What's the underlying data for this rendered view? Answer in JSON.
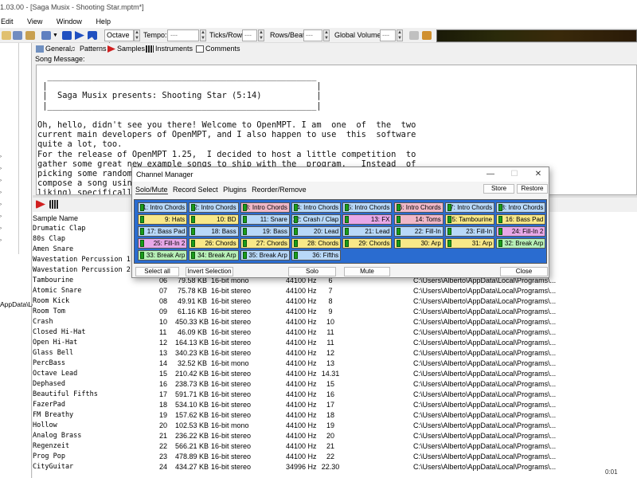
{
  "window": {
    "title": "1.03.00 - [Saga Musix - Shooting Star.mptm*]"
  },
  "menu": [
    "Edit",
    "View",
    "Window",
    "Help"
  ],
  "toolbar": {
    "octave": "Octave 4",
    "tempo_label": "Tempo:",
    "tempo_value": "---",
    "ticks_label": "Ticks/Row:",
    "ticks_value": "---",
    "rows_label": "Rows/Beat:",
    "rows_value": "---",
    "volume_label": "Global Volume:",
    "volume_value": "---"
  },
  "left_pane": {
    "label": "AppData\\Lo"
  },
  "tabs": [
    "General",
    "Patterns",
    "Samples",
    "Instruments",
    "Comments"
  ],
  "song_message_label": "Song Message:",
  "song_message": "  ______________________________________________________\n |                                                      |\n |  Saga Musix presents: Shooting Star (5:14)           |\n |______________________________________________________|\n\nOh, hello, didn't see you there! Welcome to OpenMPT. I am  one  of  the  two\ncurrent main developers of OpenMPT, and I also happen to use  this  software\nquite a lot, too.\nFor the release of OpenMPT 1.25,  I decided to host a little competition  to\ngather some great new example songs to ship with the  program.   Instead  of\npicking some random songs from my favourite  module  artists,  I  let  them\ncompose a song using\nliking) specifically",
  "sample_list": {
    "header": "Sample Name",
    "rows": [
      {
        "name": "Drumatic Clap",
        "num": "",
        "size": "",
        "fmt": "",
        "rate": "",
        "note": "",
        "path": ""
      },
      {
        "name": "80s Clap",
        "num": "",
        "size": "",
        "fmt": "",
        "rate": "",
        "note": "",
        "path": ""
      },
      {
        "name": "Amen Snare",
        "num": "",
        "size": "",
        "fmt": "",
        "rate": "",
        "note": "",
        "path": ""
      },
      {
        "name": "Wavestation Percussion 1",
        "num": "",
        "size": "",
        "fmt": "",
        "rate": "",
        "note": "",
        "path": ""
      },
      {
        "name": "Wavestation Percussion 2",
        "num": "",
        "size": "",
        "fmt": "",
        "rate": "",
        "note": "",
        "path": ""
      },
      {
        "name": "Tambourine",
        "num": "06",
        "size": "79.58 KB",
        "fmt": "16-bit mono",
        "rate": "44100 Hz",
        "note": "6",
        "path": "C:\\Users\\Alberto\\AppData\\Local\\Programs\\..."
      },
      {
        "name": "Atomic Snare",
        "num": "07",
        "size": "75.78 KB",
        "fmt": "16-bit stereo",
        "rate": "44100 Hz",
        "note": "7",
        "path": "C:\\Users\\Alberto\\AppData\\Local\\Programs\\..."
      },
      {
        "name": "Room Kick",
        "num": "08",
        "size": "49.91 KB",
        "fmt": "16-bit stereo",
        "rate": "44100 Hz",
        "note": "8",
        "path": "C:\\Users\\Alberto\\AppData\\Local\\Programs\\..."
      },
      {
        "name": "Room Tom",
        "num": "09",
        "size": "61.16 KB",
        "fmt": "16-bit stereo",
        "rate": "44100 Hz",
        "note": "9",
        "path": "C:\\Users\\Alberto\\AppData\\Local\\Programs\\..."
      },
      {
        "name": "Crash",
        "num": "10",
        "size": "450.33 KB",
        "fmt": "16-bit stereo",
        "rate": "44100 Hz",
        "note": "10",
        "path": "C:\\Users\\Alberto\\AppData\\Local\\Programs\\..."
      },
      {
        "name": "Closed Hi-Hat",
        "num": "11",
        "size": "46.09 KB",
        "fmt": "16-bit stereo",
        "rate": "44100 Hz",
        "note": "11",
        "path": "C:\\Users\\Alberto\\AppData\\Local\\Programs\\..."
      },
      {
        "name": "Open Hi-Hat",
        "num": "12",
        "size": "164.13 KB",
        "fmt": "16-bit stereo",
        "rate": "44100 Hz",
        "note": "11",
        "path": "C:\\Users\\Alberto\\AppData\\Local\\Programs\\..."
      },
      {
        "name": "Glass Bell",
        "num": "13",
        "size": "340.23 KB",
        "fmt": "16-bit stereo",
        "rate": "44100 Hz",
        "note": "12",
        "path": "C:\\Users\\Alberto\\AppData\\Local\\Programs\\..."
      },
      {
        "name": "PercBass",
        "num": "14",
        "size": "32.52 KB",
        "fmt": "16-bit mono",
        "rate": "44100 Hz",
        "note": "13",
        "path": "C:\\Users\\Alberto\\AppData\\Local\\Programs\\..."
      },
      {
        "name": "Octave Lead",
        "num": "15",
        "size": "210.42 KB",
        "fmt": "16-bit stereo",
        "rate": "44100 Hz",
        "note": "14.31",
        "path": "C:\\Users\\Alberto\\AppData\\Local\\Programs\\..."
      },
      {
        "name": "Dephased",
        "num": "16",
        "size": "238.73 KB",
        "fmt": "16-bit stereo",
        "rate": "44100 Hz",
        "note": "15",
        "path": "C:\\Users\\Alberto\\AppData\\Local\\Programs\\..."
      },
      {
        "name": "Beautiful Fifths",
        "num": "17",
        "size": "591.71 KB",
        "fmt": "16-bit stereo",
        "rate": "44100 Hz",
        "note": "16",
        "path": "C:\\Users\\Alberto\\AppData\\Local\\Programs\\..."
      },
      {
        "name": "FazerPad",
        "num": "18",
        "size": "534.10 KB",
        "fmt": "16-bit stereo",
        "rate": "44100 Hz",
        "note": "17",
        "path": "C:\\Users\\Alberto\\AppData\\Local\\Programs\\..."
      },
      {
        "name": "FM Breathy",
        "num": "19",
        "size": "157.62 KB",
        "fmt": "16-bit stereo",
        "rate": "44100 Hz",
        "note": "18",
        "path": "C:\\Users\\Alberto\\AppData\\Local\\Programs\\..."
      },
      {
        "name": "Hollow",
        "num": "20",
        "size": "102.53 KB",
        "fmt": "16-bit mono",
        "rate": "44100 Hz",
        "note": "19",
        "path": "C:\\Users\\Alberto\\AppData\\Local\\Programs\\..."
      },
      {
        "name": "Analog Brass",
        "num": "21",
        "size": "236.22 KB",
        "fmt": "16-bit stereo",
        "rate": "44100 Hz",
        "note": "20",
        "path": "C:\\Users\\Alberto\\AppData\\Local\\Programs\\..."
      },
      {
        "name": "Regenzeit",
        "num": "22",
        "size": "566.21 KB",
        "fmt": "16-bit stereo",
        "rate": "44100 Hz",
        "note": "21",
        "path": "C:\\Users\\Alberto\\AppData\\Local\\Programs\\..."
      },
      {
        "name": "Prog Pop",
        "num": "23",
        "size": "478.89 KB",
        "fmt": "16-bit stereo",
        "rate": "44100 Hz",
        "note": "22",
        "path": "C:\\Users\\Alberto\\AppData\\Local\\Programs\\..."
      },
      {
        "name": "CityGuitar",
        "num": "24",
        "size": "434.27 KB",
        "fmt": "16-bit stereo",
        "rate": "34996 Hz",
        "note": "22.30",
        "path": "C:\\Users\\Alberto\\AppData\\Local\\Programs\\..."
      }
    ]
  },
  "status_right": "0:01",
  "channel_manager": {
    "title": "Channel Manager",
    "tabs": [
      "Solo/Mute",
      "Record Select",
      "Plugins",
      "Reorder/Remove"
    ],
    "store_label": "Store",
    "restore_label": "Restore",
    "select_all_label": "Select all",
    "invert_label": "Invert Selection",
    "solo_label": "Solo",
    "mute_label": "Mute",
    "close_label": "Close",
    "channels": [
      {
        "label": "1: Intro Chords",
        "color": "#b8d8f8"
      },
      {
        "label": "2: Intro Chords",
        "color": "#b8d8f8"
      },
      {
        "label": "3: Intro Chords",
        "color": "#f0b8c8"
      },
      {
        "label": "4: Intro Chords",
        "color": "#b8d8f8"
      },
      {
        "label": "5: Intro Chords",
        "color": "#b8d8f8"
      },
      {
        "label": "6: Intro Chords",
        "color": "#f0b8c8"
      },
      {
        "label": "7: Intro Chords",
        "color": "#b8d8f8"
      },
      {
        "label": "8: Intro Chords",
        "color": "#b8d8f8"
      },
      {
        "label": "9: Hats",
        "color": "#f8e888"
      },
      {
        "label": "10: BD",
        "color": "#f8e888"
      },
      {
        "label": "11: Snare",
        "color": "#b8d8f8"
      },
      {
        "label": "12: Crash / Clap",
        "color": "#b8d8f8"
      },
      {
        "label": "13: FX",
        "color": "#e8a8e8"
      },
      {
        "label": "14: Toms",
        "color": "#f0b8c8"
      },
      {
        "label": "15: Tambourine",
        "color": "#f8e888"
      },
      {
        "label": "16: Bass Pad",
        "color": "#f8e888"
      },
      {
        "label": "17: Bass Pad",
        "color": "#b8d8f8"
      },
      {
        "label": "18: Bass",
        "color": "#b8d8f8"
      },
      {
        "label": "19: Bass",
        "color": "#b8d8f8"
      },
      {
        "label": "20: Lead",
        "color": "#b8d8f8"
      },
      {
        "label": "21: Lead",
        "color": "#b8d8f8"
      },
      {
        "label": "22: Fill-In",
        "color": "#b8d8f8"
      },
      {
        "label": "23: Fill-In",
        "color": "#b8d8f8"
      },
      {
        "label": "24: Fill-In 2",
        "color": "#e8a8e8"
      },
      {
        "label": "25: Fill-In 2",
        "color": "#e8a8e8"
      },
      {
        "label": "26: Chords",
        "color": "#f8e888"
      },
      {
        "label": "27: Chords",
        "color": "#f8e888"
      },
      {
        "label": "28: Chords",
        "color": "#f8e888"
      },
      {
        "label": "29: Chords",
        "color": "#f8e888"
      },
      {
        "label": "30: Arp",
        "color": "#f8e888"
      },
      {
        "label": "31: Arp",
        "color": "#f8e888"
      },
      {
        "label": "32: Break Arp",
        "color": "#b8f0b8"
      },
      {
        "label": "33: Break Arp",
        "color": "#b8f0b8"
      },
      {
        "label": "34: Break Arp",
        "color": "#b8f0b8"
      },
      {
        "label": "35: Break Arp",
        "color": "#b8d8f8"
      },
      {
        "label": "36: Fifths",
        "color": "#b8d8f8"
      }
    ]
  }
}
